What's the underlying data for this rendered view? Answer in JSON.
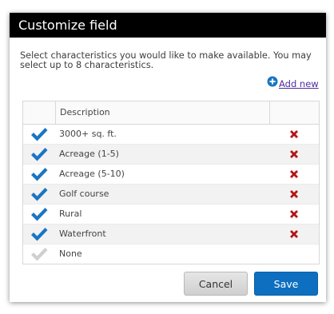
{
  "dialog": {
    "title": "Customize field",
    "instructions": "Select characteristics you would like to make available. You may select up to 8 characteristics.",
    "add_new_label": "Add new",
    "add_icon": "plus-circle-icon",
    "grid": {
      "header_description": "Description",
      "rows": [
        {
          "description": "3000+ sq. ft.",
          "checked": true,
          "deletable": true
        },
        {
          "description": "Acreage (1-5)",
          "checked": true,
          "deletable": true
        },
        {
          "description": "Acreage (5-10)",
          "checked": true,
          "deletable": true
        },
        {
          "description": "Golf course",
          "checked": true,
          "deletable": true
        },
        {
          "description": "Rural",
          "checked": true,
          "deletable": true
        },
        {
          "description": "Waterfront",
          "checked": true,
          "deletable": true
        },
        {
          "description": "None",
          "checked": false,
          "deletable": false
        }
      ]
    },
    "cancel_label": "Cancel",
    "save_label": "Save"
  },
  "colors": {
    "titlebar": "#000000",
    "check_on": "#1a75c4",
    "check_off": "#cfcfcf",
    "delete": "#b41616",
    "save_button": "#0e6fc0",
    "link": "#4d2fa0"
  }
}
